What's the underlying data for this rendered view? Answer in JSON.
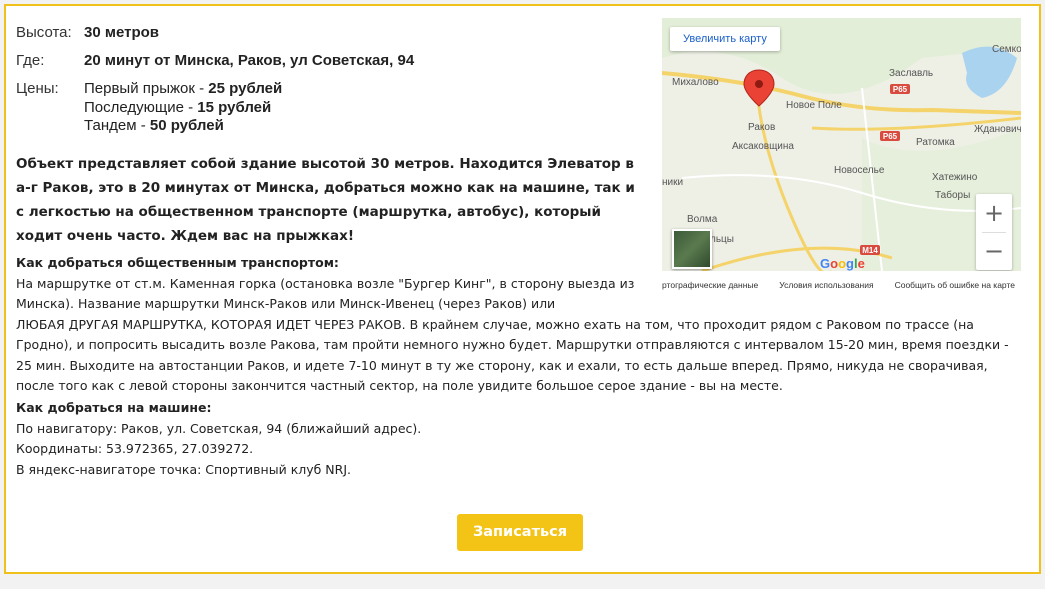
{
  "details": {
    "height_label": "Высота:",
    "height_value": "30 метров",
    "where_label": "Где:",
    "where_value": "20 минут от Минска, Раков, ул Советская, 94",
    "prices_label": "Цены:",
    "prices": [
      {
        "label": "Первый прыжок - ",
        "value": "25 рублей"
      },
      {
        "label": "Последующие - ",
        "value": "15 рублей"
      },
      {
        "label": "Тандем - ",
        "value": "50 рублей"
      }
    ]
  },
  "description": "Объект представляет собой здание высотой 30 метров. Находится Элеватор в а-г Раков, это в 20 минутах от Минска, добраться можно как на машине, так и с легкостью на общественном транспорте (маршрутка, автобус), который ходит очень часто. Ждем вас на прыжках!",
  "transport": {
    "title": "Как добраться общественным транспортом:",
    "text_part1": "На маршрутке от ст.м. Каменная горка (остановка возле \"Бургер Кинг\", в сторону выезда из Минска). Название маршрутки Минск-Раков или Минск-Ивенец (через Раков) или",
    "text_part2": "ЛЮБАЯ ДРУГАЯ МАРШРУТКА, КОТОРАЯ ИДЕТ ЧЕРЕЗ РАКОВ. В крайнем случае, можно ехать на том, что проходит рядом с Раковом по трассе (на Гродно), и попросить высадить возле Ракова, там пройти немного нужно будет. Маршрутки отправляются с интервалом 15-20 мин, время поездки - 25 мин. Выходите на автостанции Раков, и идете 7-10 минут в ту же сторону, как и ехали, то есть дальше вперед. Прямо, никуда не сворачивая, после того как с левой стороны закончится частный сектор, на поле увидите большое серое здание - вы на месте."
  },
  "car": {
    "title": "Как добраться на машине:",
    "navigator": "По навигатору: Раков, ул. Советская, 94 (ближайший адрес).",
    "coordinates": "Координаты: 53.972365, 27.039272.",
    "yandex": "В яндекс-навигаторе точка: Спортивный клуб NRJ."
  },
  "map": {
    "enlarge_label": "Увеличить карту",
    "zoom_in": "+",
    "zoom_out": "−",
    "towns": {
      "mihalovo": "Михалово",
      "novoe_pole": "Новое Поле",
      "zaslavl": "Заславль",
      "semkov": "Семко",
      "rakov": "Раков",
      "aksakovshchina": "Аксаковщина",
      "ratomka": "Ратомка",
      "zhdanovichi": "Ждановичи",
      "novoselye": "Новоселье",
      "hatezhino": "Хатежино",
      "tabory": "Таборы",
      "niki": "ники",
      "volma": "Волма",
      "ltsy": "льцы"
    },
    "roads": {
      "p65a": "P65",
      "p65b": "P65",
      "m14": "M14"
    },
    "logo": [
      "G",
      "o",
      "o",
      "g",
      "l",
      "e"
    ],
    "footer": [
      "ртографические данные",
      "Условия использования",
      "Сообщить об ошибке на карте"
    ],
    "colors": {
      "marker": "#ea4335",
      "road_major": "#f5d36b",
      "water": "#aad3f0"
    }
  },
  "signup_label": "Записаться",
  "theme": {
    "accent": "#f3c315",
    "border": "#f0c11b"
  }
}
